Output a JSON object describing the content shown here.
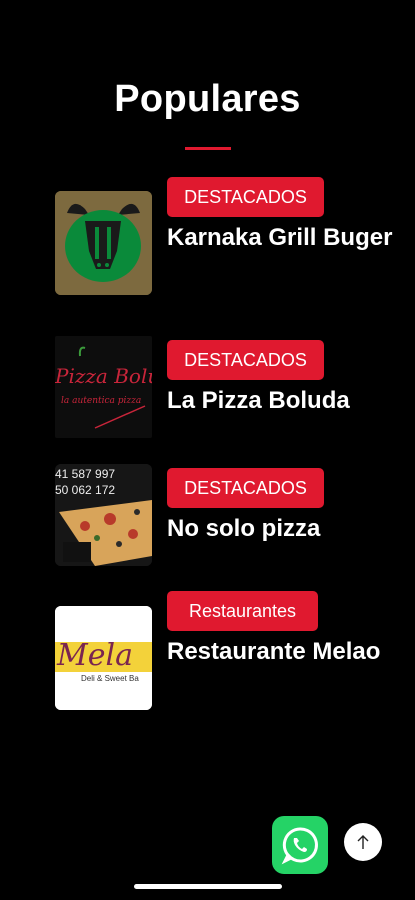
{
  "page": {
    "title": "Populares"
  },
  "items": [
    {
      "badge": "DESTACADOS",
      "name": "Karnaka Grill Buger",
      "logo": "bull-head-logo"
    },
    {
      "badge": "DESTACADOS",
      "name": "La Pizza Boluda",
      "logo_text": "Pizza Bolu",
      "logo_sub": "la autentica pizza"
    },
    {
      "badge": "DESTACADOS",
      "name": "No solo pizza",
      "phone_1": "41 587 997",
      "phone_2": "50 062 172"
    },
    {
      "badge": "Restaurantes",
      "name": "Restaurante Melao",
      "logo_text": "Mela",
      "logo_sub": "Deli & Sweet Ba"
    }
  ],
  "colors": {
    "accent": "#e0192f",
    "whatsapp": "#25d366",
    "background": "#000000"
  },
  "icons": {
    "whatsapp": "whatsapp-icon",
    "scroll_top": "arrow-up-icon"
  }
}
